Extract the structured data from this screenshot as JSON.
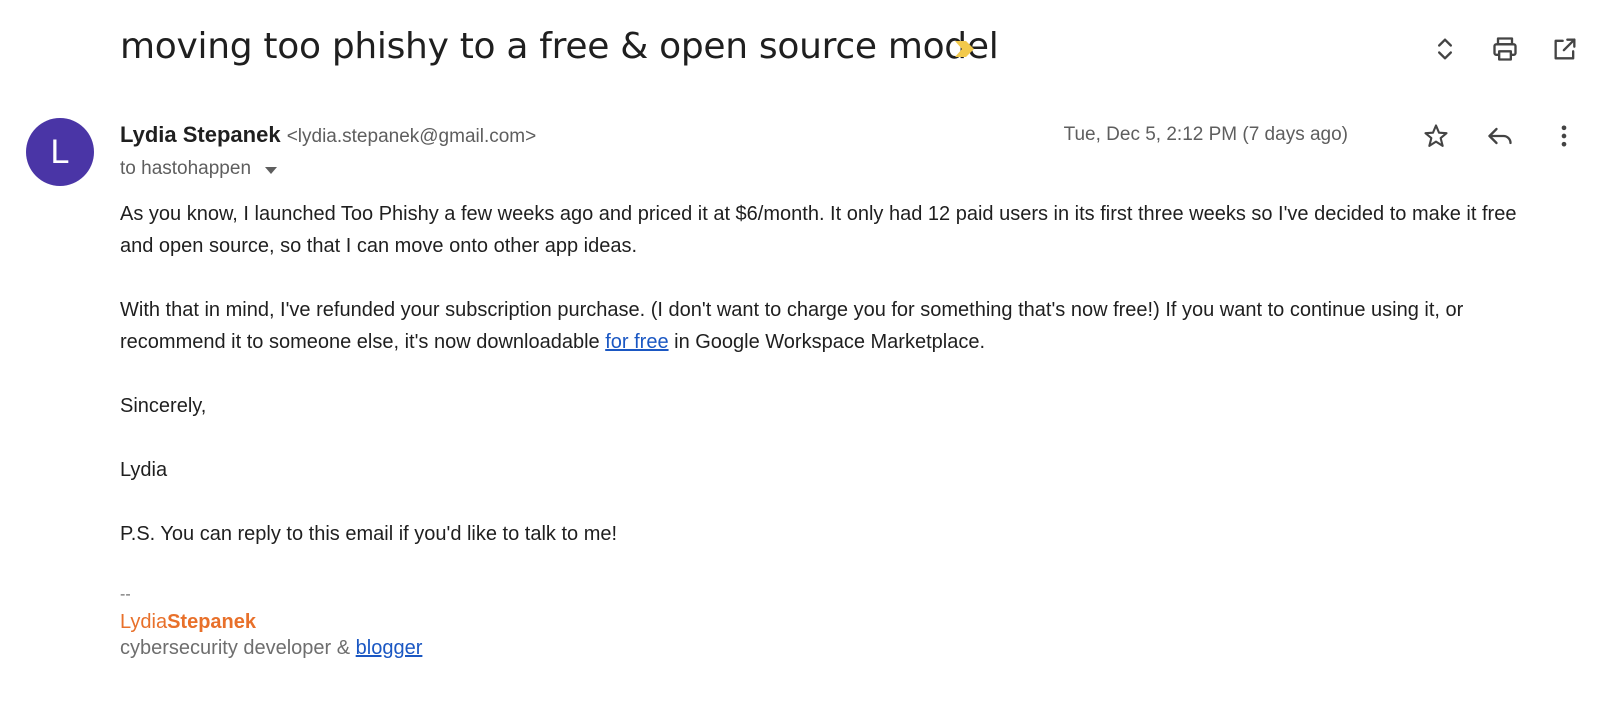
{
  "subject": "moving too phishy to a free & open source model",
  "colors": {
    "avatar_bg": "#4a35a6",
    "importance": "#f2c94c",
    "signature": "#e8702a",
    "link": "#1a57c3"
  },
  "header_icons": [
    "expand-collapse-icon",
    "print-icon",
    "open-new-window-icon"
  ],
  "sender": {
    "avatar_letter": "L",
    "name": "Lydia Stepanek",
    "email": "<lydia.stepanek@gmail.com>",
    "to": "to hastohappen",
    "date": "Tue, Dec 5, 2:12 PM (7 days ago)"
  },
  "body": {
    "p1": "As you know, I launched Too Phishy a few weeks ago and priced it at $6/month. It only had 12 paid users in its first three weeks so I've decided to make it free and open source, so that I can move onto other app ideas.",
    "p2_before": "With that in mind, I've refunded your subscription purchase. (I don't want to charge you for something that's now free!) If you want to continue using it, or recommend it to someone else, it's now downloadable ",
    "p2_link": "for free",
    "p2_after": " in Google Workspace Marketplace.",
    "closing": "Sincerely,",
    "name": "Lydia",
    "ps": "P.S. You can reply to this email if you'd like to talk to me!"
  },
  "signature": {
    "dash": "--",
    "first": "Lydia",
    "last": "Stepanek",
    "title_before": "cybersecurity developer & ",
    "title_link": "blogger"
  }
}
